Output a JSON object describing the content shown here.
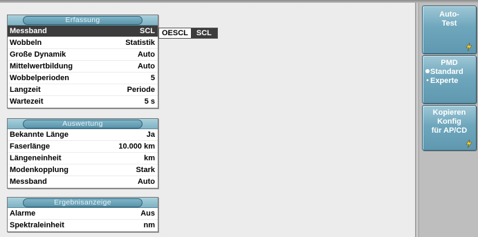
{
  "panels": {
    "erfassung": {
      "title": "Erfassung",
      "rows": [
        {
          "label": "Messband",
          "value": "SCL"
        },
        {
          "label": "Wobbeln",
          "value": "Statistik"
        },
        {
          "label": "Große Dynamik",
          "value": "Auto"
        },
        {
          "label": "Mittelwertbildung",
          "value": "Auto"
        },
        {
          "label": "Wobbelperioden",
          "value": "5"
        },
        {
          "label": "Langzeit",
          "value": "Periode"
        },
        {
          "label": "Wartezeit",
          "value": "5 s"
        }
      ]
    },
    "auswertung": {
      "title": "Auswertung",
      "rows": [
        {
          "label": "Bekannte Länge",
          "value": "Ja"
        },
        {
          "label": "Faserlänge",
          "value": "10.000 km"
        },
        {
          "label": "Längeneinheit",
          "value": "km"
        },
        {
          "label": "Modenkopplung",
          "value": "Stark"
        },
        {
          "label": "Messband",
          "value": "Auto"
        }
      ]
    },
    "ergebnisanzeige": {
      "title": "Ergebnisanzeige",
      "rows": [
        {
          "label": "Alarme",
          "value": "Aus"
        },
        {
          "label": "Spektraleinheit",
          "value": "nm"
        }
      ]
    }
  },
  "messband_options": [
    "OESCL",
    "SCL"
  ],
  "softkeys": {
    "autotest": {
      "line1": "Auto-",
      "line2": "Test",
      "icon": "lightning-icon"
    },
    "pmd": {
      "title": "PMD",
      "option1": "Standard",
      "option2": "Experte",
      "selected": "Experte"
    },
    "kopieren": {
      "line1": "Kopieren",
      "line2": "Konfig",
      "line3": "für AP/CD",
      "icon": "lightning-icon"
    }
  },
  "colors": {
    "accent": "#6ea6bc",
    "selected_row": "#3c3c3c",
    "panel_header": "#7fb3c4"
  }
}
